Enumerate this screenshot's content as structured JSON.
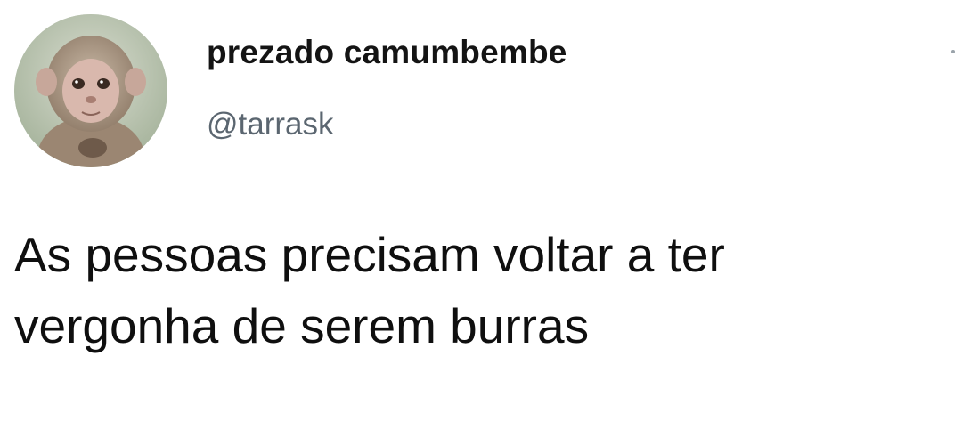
{
  "author": {
    "display_name": "prezado camumbembe",
    "handle": "@tarrask",
    "avatar_icon": "monkey-avatar"
  },
  "tweet": {
    "lines": [
      "As pessoas precisam voltar a ter",
      "vergonha de serem burras"
    ]
  },
  "colors": {
    "name_text": "#141414",
    "handle_text": "#5b6670",
    "body_text": "#0f0f0f",
    "background": "#ffffff"
  }
}
